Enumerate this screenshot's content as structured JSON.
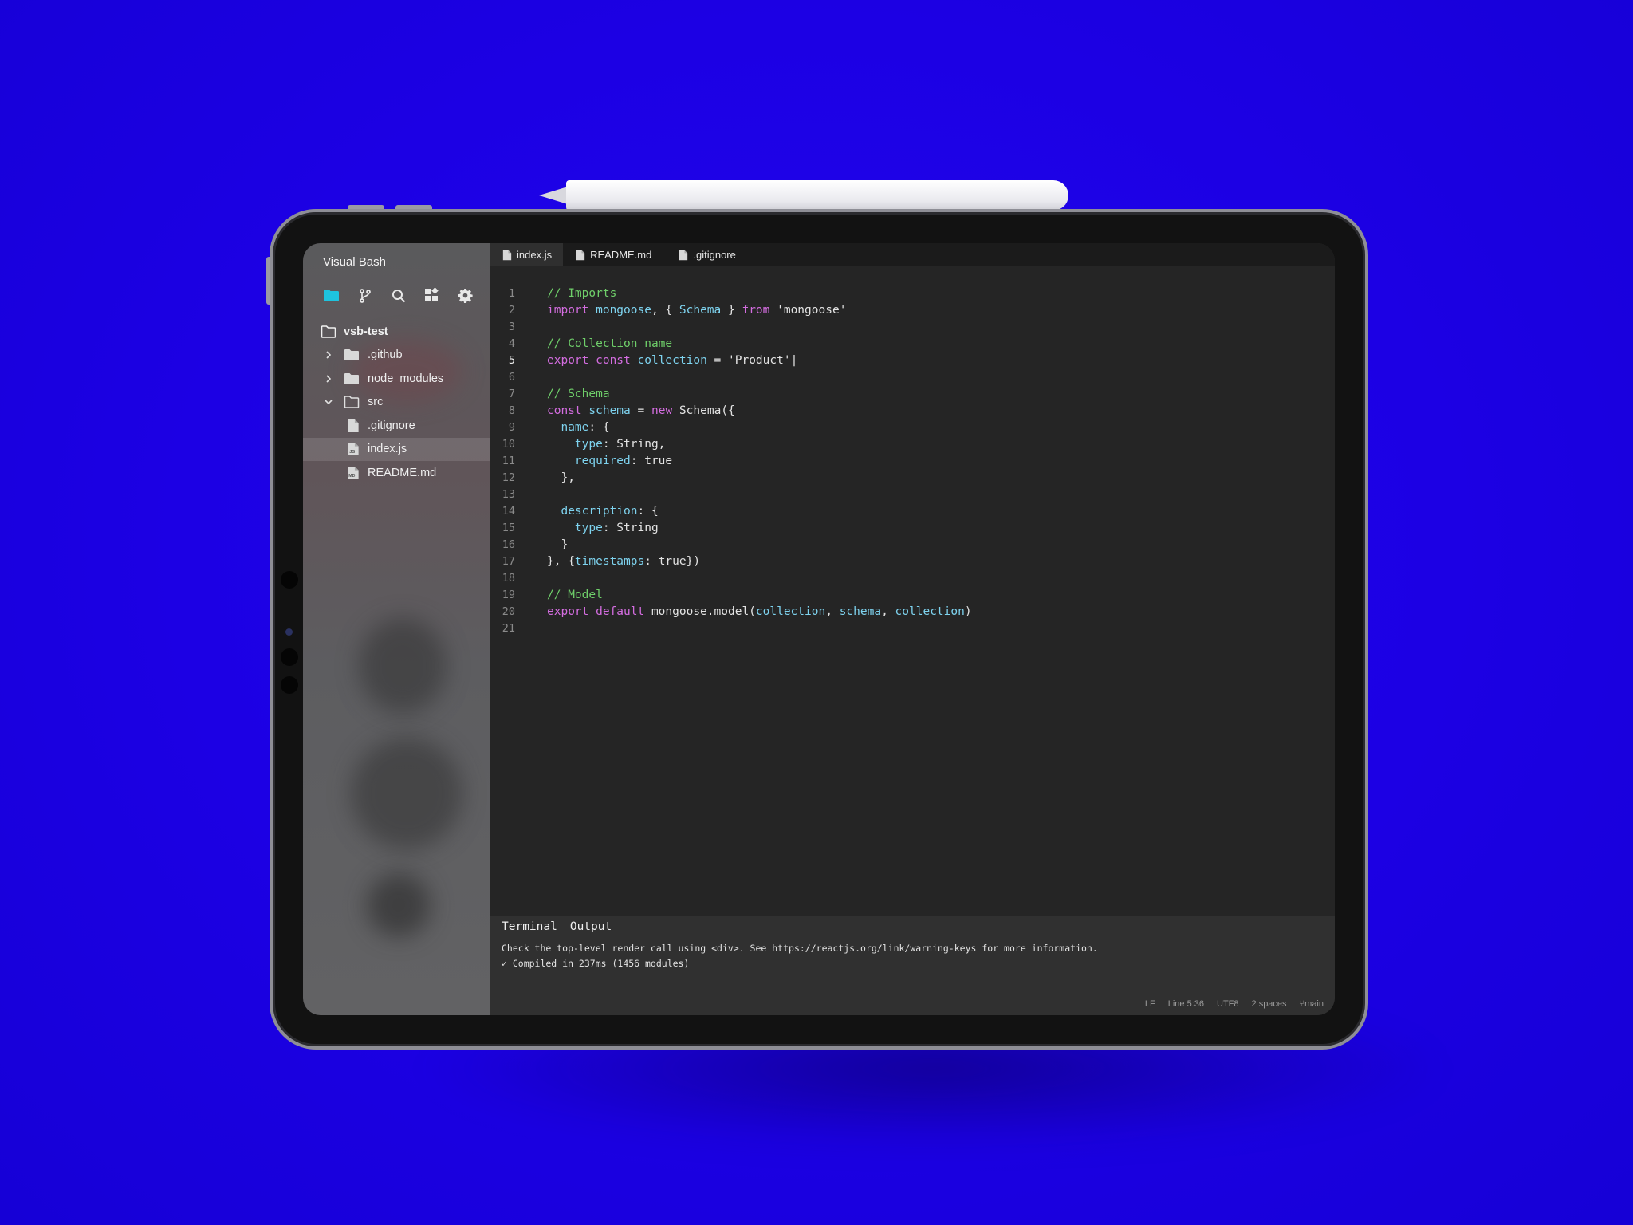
{
  "app": {
    "title": "Visual Bash"
  },
  "toolbar": {
    "icons": [
      "folder-icon",
      "source-control-icon",
      "search-icon",
      "extensions-icon",
      "gear-icon"
    ],
    "active_color": "#1ec3de"
  },
  "explorer": {
    "root": "vsb-test",
    "items": [
      {
        "label": ".github",
        "type": "folder",
        "expanded": false
      },
      {
        "label": "node_modules",
        "type": "folder",
        "expanded": false
      },
      {
        "label": "src",
        "type": "folder",
        "expanded": true
      },
      {
        "label": ".gitignore",
        "type": "file"
      },
      {
        "label": "index.js",
        "type": "file",
        "selected": true
      },
      {
        "label": "README.md",
        "type": "file"
      }
    ]
  },
  "tabs": [
    {
      "label": "index.js",
      "active": true
    },
    {
      "label": "README.md",
      "active": false
    },
    {
      "label": ".gitignore",
      "active": false
    }
  ],
  "editor": {
    "current_line": 5,
    "lines": [
      {
        "n": "1",
        "tokens": [
          {
            "t": "// Imports",
            "c": "com"
          }
        ]
      },
      {
        "n": "2",
        "tokens": [
          {
            "t": "import ",
            "c": "kw"
          },
          {
            "t": "mongoose",
            "c": "var"
          },
          {
            "t": ", { ",
            "c": "p"
          },
          {
            "t": "Schema",
            "c": "var"
          },
          {
            "t": " } ",
            "c": "p"
          },
          {
            "t": "from",
            "c": "kw"
          },
          {
            "t": " 'mongoose'",
            "c": "str"
          }
        ]
      },
      {
        "n": "3",
        "tokens": []
      },
      {
        "n": "4",
        "tokens": [
          {
            "t": "// Collection name",
            "c": "com"
          }
        ]
      },
      {
        "n": "5",
        "tokens": [
          {
            "t": "export const ",
            "c": "kw"
          },
          {
            "t": "collection",
            "c": "var"
          },
          {
            "t": " = 'Product'|",
            "c": "str"
          }
        ]
      },
      {
        "n": "6",
        "tokens": []
      },
      {
        "n": "7",
        "tokens": [
          {
            "t": "// Schema",
            "c": "com"
          }
        ]
      },
      {
        "n": "8",
        "tokens": [
          {
            "t": "const ",
            "c": "kw"
          },
          {
            "t": "schema",
            "c": "var"
          },
          {
            "t": " = ",
            "c": "p"
          },
          {
            "t": "new",
            "c": "kw"
          },
          {
            "t": " Schema({",
            "c": "p"
          }
        ]
      },
      {
        "n": "9",
        "tokens": [
          {
            "t": "  ",
            "c": "p"
          },
          {
            "t": "name",
            "c": "var"
          },
          {
            "t": ": {",
            "c": "p"
          }
        ]
      },
      {
        "n": "10",
        "tokens": [
          {
            "t": "    ",
            "c": "p"
          },
          {
            "t": "type",
            "c": "var"
          },
          {
            "t": ": String,",
            "c": "p"
          }
        ]
      },
      {
        "n": "11",
        "tokens": [
          {
            "t": "    ",
            "c": "p"
          },
          {
            "t": "required",
            "c": "var"
          },
          {
            "t": ": true",
            "c": "p"
          }
        ]
      },
      {
        "n": "12",
        "tokens": [
          {
            "t": "  },",
            "c": "p"
          }
        ]
      },
      {
        "n": "13",
        "tokens": []
      },
      {
        "n": "14",
        "tokens": [
          {
            "t": "  ",
            "c": "p"
          },
          {
            "t": "description",
            "c": "var"
          },
          {
            "t": ": {",
            "c": "p"
          }
        ]
      },
      {
        "n": "15",
        "tokens": [
          {
            "t": "    ",
            "c": "p"
          },
          {
            "t": "type",
            "c": "var"
          },
          {
            "t": ": String",
            "c": "p"
          }
        ]
      },
      {
        "n": "16",
        "tokens": [
          {
            "t": "  }",
            "c": "p"
          }
        ]
      },
      {
        "n": "17",
        "tokens": [
          {
            "t": "}, {",
            "c": "p"
          },
          {
            "t": "timestamps",
            "c": "var"
          },
          {
            "t": ": true})",
            "c": "p"
          }
        ]
      },
      {
        "n": "18",
        "tokens": []
      },
      {
        "n": "19",
        "tokens": [
          {
            "t": "// Model",
            "c": "com"
          }
        ]
      },
      {
        "n": "20",
        "tokens": [
          {
            "t": "export default ",
            "c": "kw"
          },
          {
            "t": "mongoose.model(",
            "c": "p"
          },
          {
            "t": "collection",
            "c": "var"
          },
          {
            "t": ", ",
            "c": "p"
          },
          {
            "t": "schema",
            "c": "var"
          },
          {
            "t": ", ",
            "c": "p"
          },
          {
            "t": "collection",
            "c": "var"
          },
          {
            "t": ")",
            "c": "p"
          }
        ]
      },
      {
        "n": "21",
        "tokens": []
      }
    ]
  },
  "panel": {
    "tabs": [
      "Terminal",
      "Output"
    ],
    "lines": [
      "Check the top-level render call using <div>. See https://reactjs.org/link/warning-keys for more information.",
      "✓ Compiled in 237ms (1456 modules)"
    ]
  },
  "status": {
    "eol": "LF",
    "position": "Line 5:36",
    "encoding": "UTF8",
    "indent": "2 spaces",
    "branch": "main"
  },
  "colors": {
    "background": "#1d00e8",
    "comment": "#6fcf6a",
    "keyword": "#d46de0",
    "identifier": "#7ed3ef"
  }
}
